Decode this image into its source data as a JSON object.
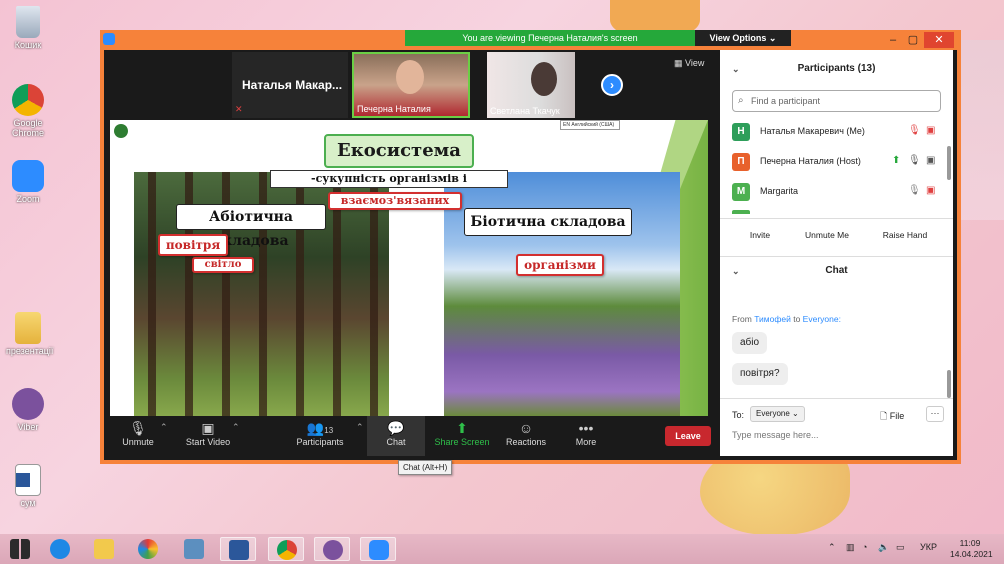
{
  "desktop": {
    "icons": [
      {
        "label": "Кошик"
      },
      {
        "label": "Google Chrome"
      },
      {
        "label": "Zoom"
      },
      {
        "label": "презентації"
      },
      {
        "label": "Viber"
      },
      {
        "label": "сум"
      }
    ]
  },
  "zoom": {
    "banner": "You are viewing Печерна Наталия's screen",
    "view_options": "View Options ⌄",
    "view_btn": "View",
    "tiles": [
      {
        "name": "Наталья Макар..."
      },
      {
        "name": "Печерна Наталия"
      },
      {
        "name": "Светлана Ткачук"
      }
    ],
    "toolbar": {
      "unmute": "Unmute",
      "start_video": "Start Video",
      "participants": "Participants",
      "participants_count": "13",
      "chat": "Chat",
      "share_screen": "Share Screen",
      "reactions": "Reactions",
      "more": "More",
      "leave": "Leave"
    },
    "tooltip": "Chat (Alt+H)"
  },
  "slide": {
    "lang_tag": "EN Английский (США)",
    "title": "Екосистема",
    "subtitle": "-сукупність організмів і середовища",
    "interconnected": "взаємоз'вязаних",
    "abiotic": "Абіотична складова",
    "air": "повітря",
    "light": "світло",
    "biotic": "Біотична складова",
    "organisms": "організми"
  },
  "panel": {
    "participants_title": "Participants (13)",
    "search_placeholder": "Find a participant",
    "participants": [
      {
        "initial": "Н",
        "name": "Наталья Макаревич (Me)",
        "color": "#2e9e5a"
      },
      {
        "initial": "П",
        "name": "Печерна Наталия (Host)",
        "color": "#e8612c"
      },
      {
        "initial": "M",
        "name": "Margarita",
        "color": "#4cb050"
      }
    ],
    "invite": "Invite",
    "unmute_me": "Unmute Me",
    "raise_hand": "Raise Hand",
    "chat_title": "Chat",
    "from_prefix": "From",
    "from_name": "Тимофей",
    "to_word": "to",
    "to_name": "Everyone:",
    "messages": [
      "абіо",
      "повітря?"
    ],
    "to_label": "To:",
    "to_value": "Everyone ⌄",
    "file": "File",
    "more": "···",
    "input_placeholder": "Type message here..."
  },
  "taskbar": {
    "lang": "УКР",
    "time": "11:09",
    "date": "14.04.2021"
  }
}
